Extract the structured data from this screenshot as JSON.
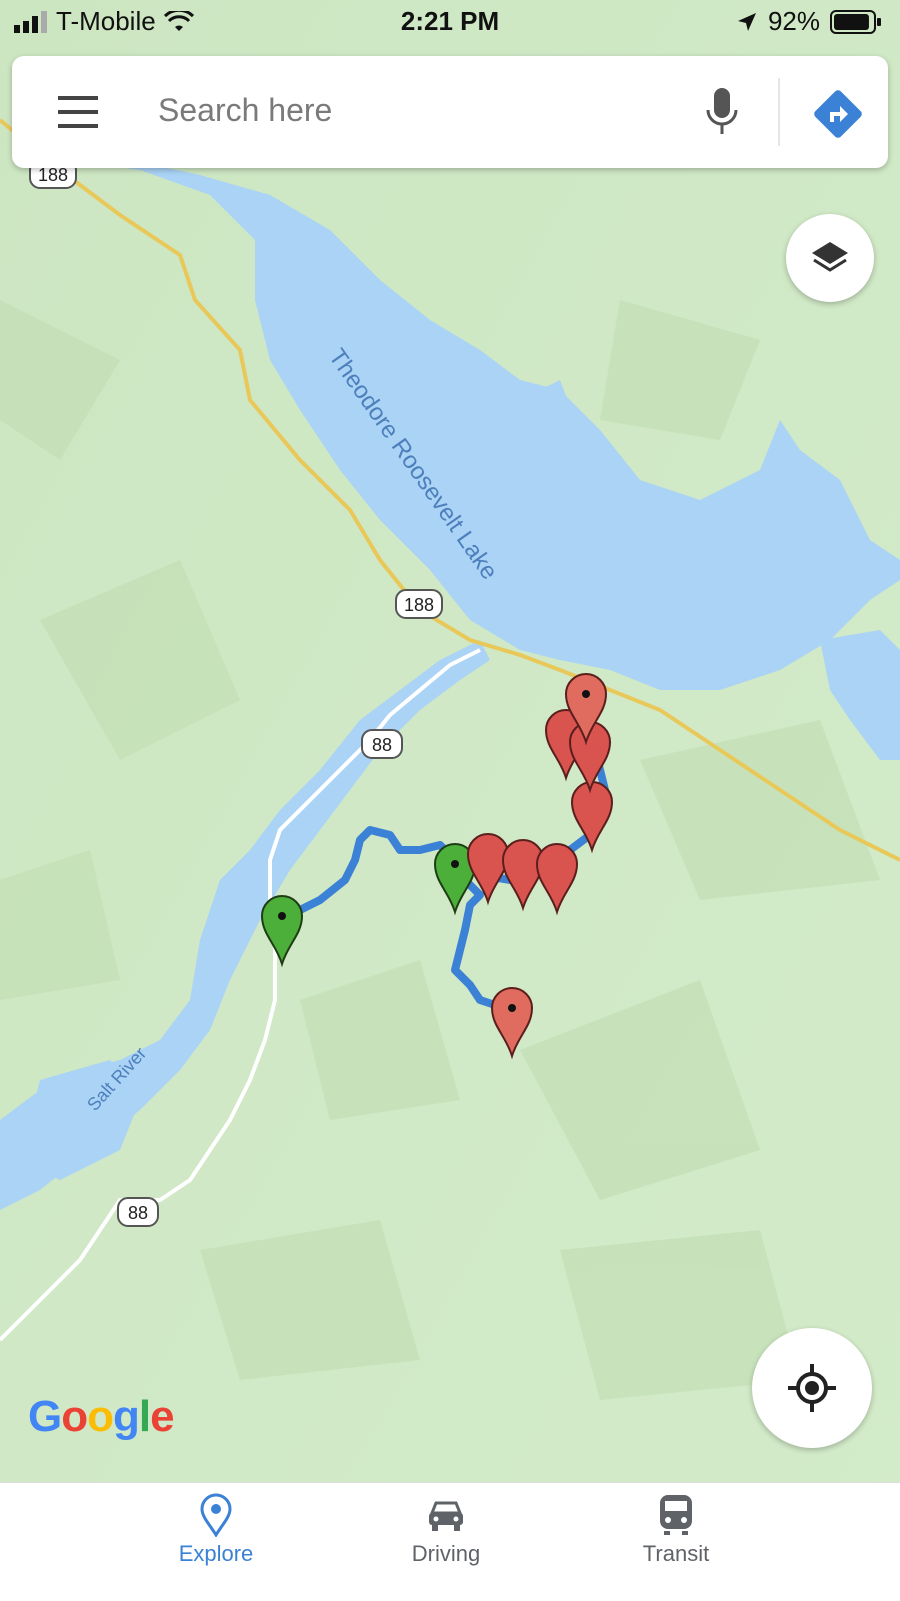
{
  "status_bar": {
    "carrier": "T-Mobile",
    "time": "2:21 PM",
    "battery": "92%",
    "battery_level": 0.92
  },
  "search": {
    "placeholder": "Search here",
    "icons": [
      "menu-icon",
      "mic-icon",
      "directions-icon"
    ]
  },
  "map": {
    "lake_label": "Theodore Roosevelt Lake",
    "river_label": "Salt River",
    "road_shields": [
      "188",
      "188",
      "88",
      "88"
    ],
    "colors": {
      "land": "#cfe8c6",
      "water": "#aad3f5",
      "route": "#3b82d6",
      "marker_start": "#4caf3a",
      "marker_waypoint": "#d9534f",
      "highway": "#f2d46b"
    }
  },
  "controls": {
    "layers_icon": "layers-icon",
    "locate_icon": "my-location-icon"
  },
  "branding": {
    "logo": "Google"
  },
  "bottom_nav": {
    "items": [
      {
        "label": "Explore",
        "icon": "explore-pin-icon",
        "active": true
      },
      {
        "label": "Driving",
        "icon": "car-icon",
        "active": false
      },
      {
        "label": "Transit",
        "icon": "train-icon",
        "active": false
      }
    ],
    "active_color": "#3b82d6",
    "inactive_color": "#5f6368"
  }
}
